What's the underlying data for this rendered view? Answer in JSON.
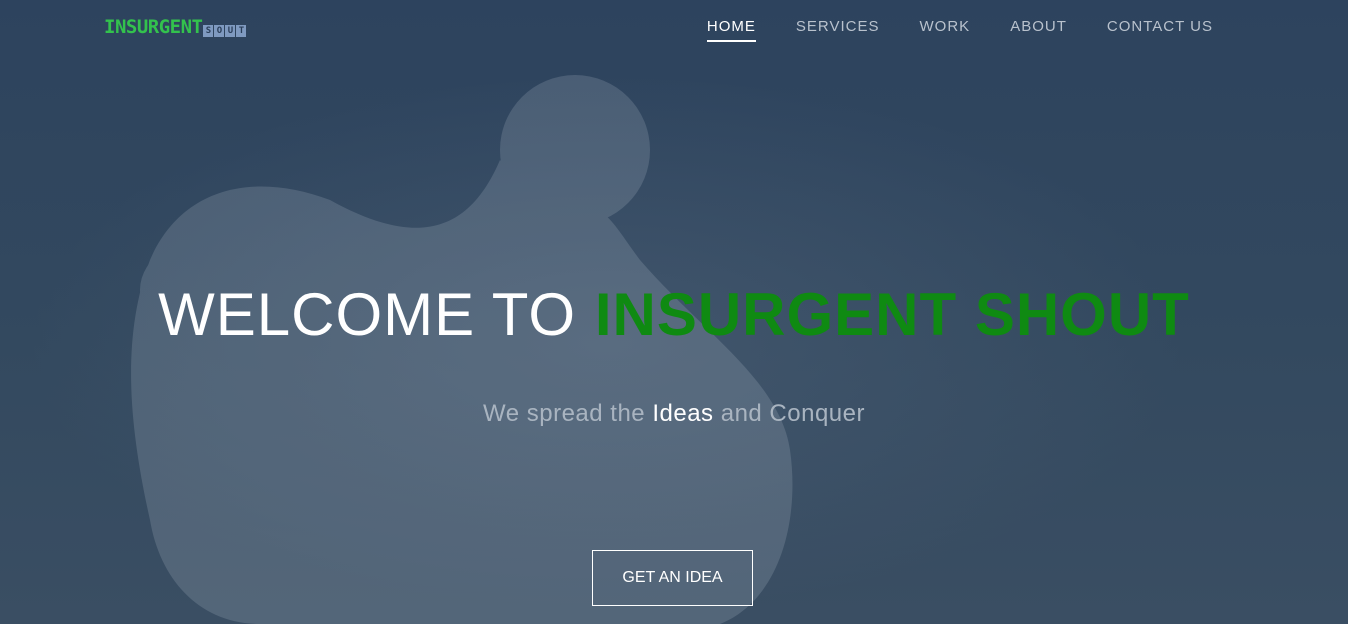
{
  "logo": {
    "main": "INSURGENT",
    "sub_letters": [
      "S",
      "O",
      "U",
      "T"
    ]
  },
  "nav": {
    "items": [
      {
        "label": "HOME",
        "active": true
      },
      {
        "label": "SERVICES",
        "active": false
      },
      {
        "label": "WORK",
        "active": false
      },
      {
        "label": "ABOUT",
        "active": false
      },
      {
        "label": "CONTACT US",
        "active": false
      }
    ]
  },
  "hero": {
    "headline_plain": "WELCOME TO",
    "headline_brand": "INSURGENT SHOUT",
    "tagline_before": "We spread the",
    "tagline_em": "Ideas",
    "tagline_after": "and Conquer",
    "cta_label": "GET AN IDEA"
  },
  "colors": {
    "background": "#2f4560",
    "brand_green": "#0f8a12",
    "logo_green": "#33c24d",
    "nav_text": "#b9c2cd",
    "tagline_text": "#a9b4c0"
  },
  "icons": {
    "background_image": "thinker-statue-icon"
  }
}
